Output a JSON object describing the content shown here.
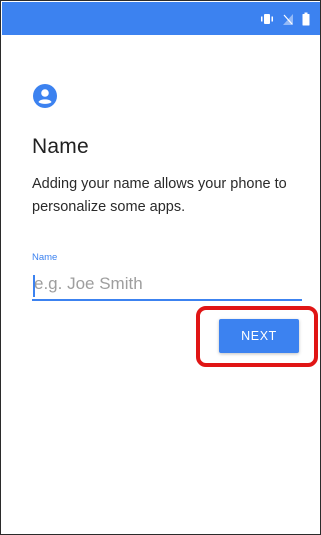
{
  "status_bar": {
    "color": "#3c82f0",
    "icons": [
      "vibrate-icon",
      "signal-icon",
      "battery-icon"
    ]
  },
  "header": {
    "icon": "account-circle-icon",
    "title": "Name",
    "description": "Adding your name allows your phone to personalize some apps."
  },
  "form": {
    "field_label": "Name",
    "field_value": "",
    "field_placeholder": "e.g. Joe Smith"
  },
  "actions": {
    "next_label": "NEXT"
  },
  "colors": {
    "accent": "#3c82f0",
    "highlight": "#e01515"
  }
}
